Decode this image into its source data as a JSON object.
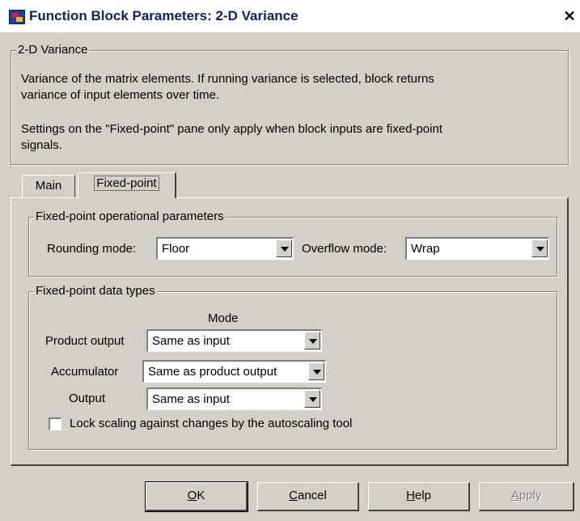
{
  "window": {
    "title": "Function Block Parameters: 2-D Variance",
    "close_glyph": "✕",
    "icon": "simulink-block-icon"
  },
  "description_group": {
    "title": "2-D Variance",
    "line1": "Variance of the matrix elements. If running variance is selected, block returns",
    "line2": "variance of input elements over time.",
    "line3": "Settings on the \"Fixed-point\" pane only apply when block inputs are fixed-point",
    "line4": "signals."
  },
  "tabs": [
    {
      "label": "Main",
      "active": false
    },
    {
      "label": "Fixed-point",
      "active": true
    }
  ],
  "operational_params": {
    "title": "Fixed-point operational parameters",
    "rounding_label": "Rounding mode:",
    "rounding_value": "Floor",
    "overflow_label": "Overflow mode:",
    "overflow_value": "Wrap"
  },
  "data_types": {
    "title": "Fixed-point data types",
    "mode_header": "Mode",
    "rows": [
      {
        "label": "Product output",
        "value": "Same as input"
      },
      {
        "label": "Accumulator",
        "value": "Same as product output"
      },
      {
        "label": "Output",
        "value": "Same as input"
      }
    ],
    "lock_scaling_label": "Lock scaling against changes by the autoscaling tool",
    "lock_scaling_checked": false
  },
  "buttons": {
    "ok_hotkey": "O",
    "ok_rest": "K",
    "cancel_hotkey": "C",
    "cancel_rest": "ancel",
    "help_hotkey": "H",
    "help_rest": "elp",
    "apply_hotkey": "A",
    "apply_rest": "pply",
    "apply_enabled": false
  },
  "colors": {
    "dialog_bg": "#d4d0c8",
    "title_text": "#0a246a",
    "disabled_text": "#808080"
  }
}
